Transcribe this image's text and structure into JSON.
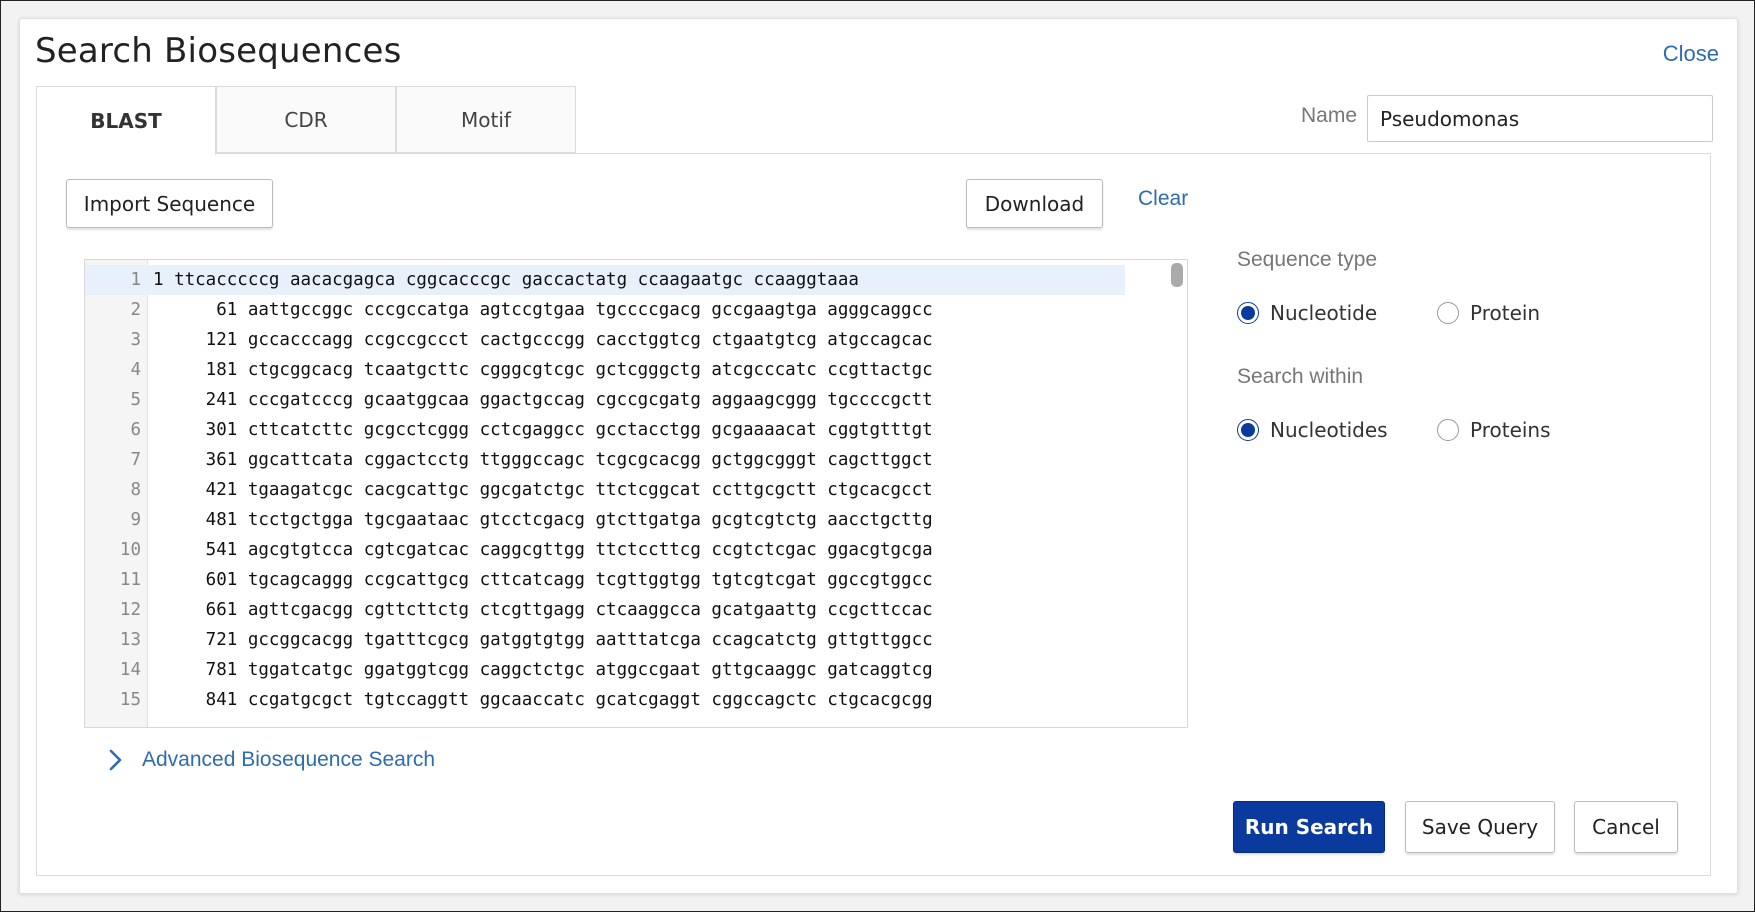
{
  "dialog": {
    "title": "Search Biosequences",
    "close_label": "Close"
  },
  "tabs": [
    {
      "label": "BLAST",
      "active": true
    },
    {
      "label": "CDR",
      "active": false
    },
    {
      "label": "Motif",
      "active": false
    }
  ],
  "name_field": {
    "label": "Name",
    "value": "Pseudomonas"
  },
  "toolbar": {
    "import_label": "Import Sequence",
    "download_label": "Download",
    "clear_label": "Clear"
  },
  "editor": {
    "lines": [
      {
        "n": "1",
        "text": "1 ttcacccccg aacacgagca cggcacccgc gaccactatg ccaagaatgc ccaaggtaaa"
      },
      {
        "n": "2",
        "text": "      61 aattgccggc cccgccatga agtccgtgaa tgccccgacg gccgaagtga agggcaggcc"
      },
      {
        "n": "3",
        "text": "     121 gccacccagg ccgccgccct cactgcccgg cacctggtcg ctgaatgtcg atgccagcac"
      },
      {
        "n": "4",
        "text": "     181 ctgcggcacg tcaatgcttc cgggcgtcgc gctcgggctg atcgcccatc ccgttactgc"
      },
      {
        "n": "5",
        "text": "     241 cccgatcccg gcaatggcaa ggactgccag cgccgcgatg aggaagcggg tgccccgctt"
      },
      {
        "n": "6",
        "text": "     301 cttcatcttc gcgcctcggg cctcgaggcc gcctacctgg gcgaaaacat cggtgtttgt"
      },
      {
        "n": "7",
        "text": "     361 ggcattcata cggactcctg ttgggccagc tcgcgcacgg gctggcgggt cagcttggct"
      },
      {
        "n": "8",
        "text": "     421 tgaagatcgc cacgcattgc ggcgatctgc ttctcggcat ccttgcgctt ctgcacgcct"
      },
      {
        "n": "9",
        "text": "     481 tcctgctgga tgcgaataac gtcctcgacg gtcttgatga gcgtcgtctg aacctgcttg"
      },
      {
        "n": "10",
        "text": "     541 agcgtgtcca cgtcgatcac caggcgttgg ttctccttcg ccgtctcgac ggacgtgcga"
      },
      {
        "n": "11",
        "text": "     601 tgcagcaggg ccgcattgcg cttcatcagg tcgttggtgg tgtcgtcgat ggccgtggcc"
      },
      {
        "n": "12",
        "text": "     661 agttcgacgg cgttcttctg ctcgttgagg ctcaaggcca gcatgaattg ccgcttccac"
      },
      {
        "n": "13",
        "text": "     721 gccggcacgg tgatttcgcg gatggtgtgg aatttatcga ccagcatctg gttgttggcc"
      },
      {
        "n": "14",
        "text": "     781 tggatcatgc ggatggtcgg caggctctgc atggccgaat gttgcaaggc gatcaggtcg"
      },
      {
        "n": "15",
        "text": "     841 ccgatgcgct tgtccaggtt ggcaaccatc gcatcgaggt cggccagctc ctgcacgcgg"
      }
    ]
  },
  "advanced": {
    "label": "Advanced Biosequence Search"
  },
  "sequence_type": {
    "label": "Sequence type",
    "options": [
      {
        "label": "Nucleotide",
        "selected": true
      },
      {
        "label": "Protein",
        "selected": false
      }
    ]
  },
  "search_within": {
    "label": "Search within",
    "options": [
      {
        "label": "Nucleotides",
        "selected": true
      },
      {
        "label": "Proteins",
        "selected": false
      }
    ]
  },
  "footer": {
    "run_label": "Run Search",
    "save_label": "Save Query",
    "cancel_label": "Cancel"
  },
  "colors": {
    "primary": "#0a3a9e",
    "link": "#2e6bb0"
  }
}
